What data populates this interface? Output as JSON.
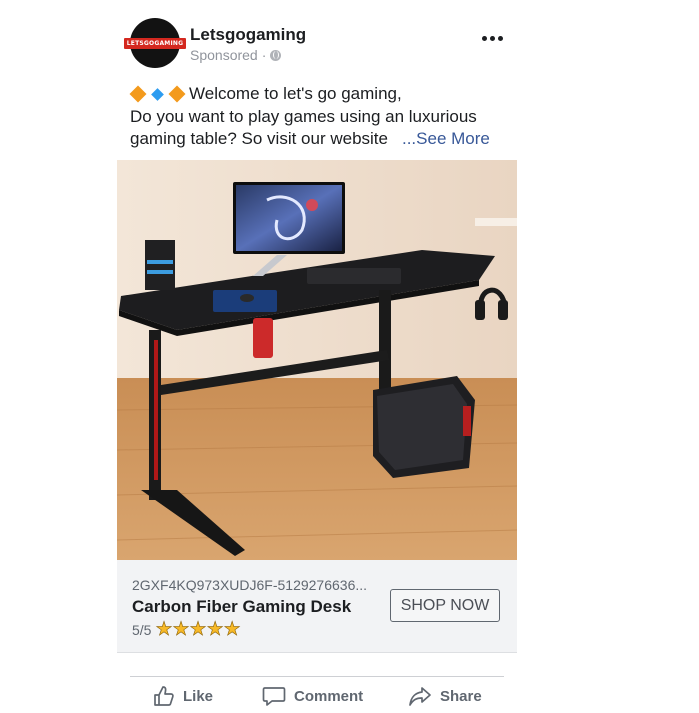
{
  "post": {
    "page_name": "Letsgogaming",
    "avatar_text": "LETSGOGAMING",
    "sponsored": "Sponsored",
    "separator": "·",
    "caption": {
      "line1": "Welcome to let's go gaming,",
      "line2": "Do you want to play games using an luxurious",
      "line3": "gaming table? So visit our website",
      "see_more": "...See More"
    }
  },
  "link": {
    "url": "2GXF4KQ973XUDJ6F-5129276636...",
    "title": "Carbon Fiber Gaming Desk",
    "rating": "5/5",
    "stars": "★★★★★",
    "cta": "SHOP NOW"
  },
  "actions": {
    "like": "Like",
    "comment": "Comment",
    "share": "Share"
  },
  "colors": {
    "link_blue": "#385898",
    "muted": "#606770",
    "star": "#f7b928",
    "brand_red": "#d4281f"
  }
}
